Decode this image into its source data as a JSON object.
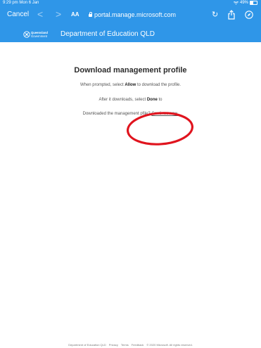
{
  "status_bar": {
    "time": "9:29 pm",
    "date": "Mon 6 Jan",
    "battery_percent": "49%",
    "battery_level": 0.49
  },
  "browser": {
    "cancel_label": "Cancel",
    "back_glyph": "<",
    "forward_glyph": ">",
    "text_size_label": "AA",
    "url": "portal.manage.microsoft.com",
    "reload_glyph": "↻",
    "icons": [
      "lock-icon",
      "reload-icon",
      "share-icon",
      "compass-icon",
      "wifi-icon",
      "battery-icon"
    ]
  },
  "header": {
    "logo_text_line1": "Queensland",
    "logo_text_line2": "Government",
    "title": "Department of Education QLD"
  },
  "content": {
    "title": "Download management profile",
    "line1_prefix": "When prompted, select ",
    "line1_bold": "Allow",
    "line1_suffix": " to download the profile.",
    "line2_prefix": "After it downloads, select ",
    "line2_bold": "Done",
    "line2_suffix": " to ",
    "line3_prefix": "Downloaded the management p",
    "line3_middle": "file? ",
    "continue_link": "Continue now."
  },
  "footer": {
    "org": "Department of Education QLD",
    "privacy": "Privacy",
    "terms": "Terms",
    "feedback": "Feedback",
    "copyright": "© 2020 Microsoft. All rights reserved."
  },
  "colors": {
    "brand_blue": "#2f96e8",
    "annotation_red": "#e0141e",
    "title_text": "#2b2b2b"
  }
}
